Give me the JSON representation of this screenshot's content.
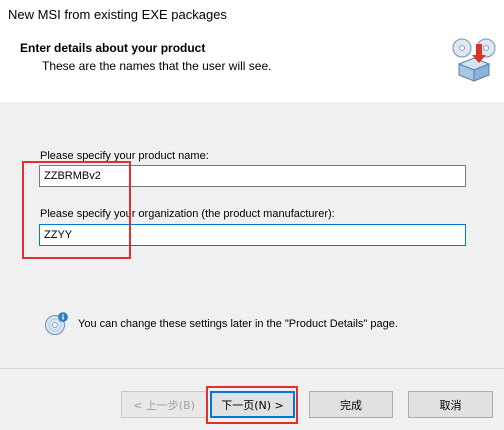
{
  "window": {
    "title": "New MSI from existing EXE packages"
  },
  "header": {
    "heading": "Enter details about your product",
    "subheading": "These are the names that the user will see."
  },
  "form": {
    "product_name_label": "Please specify your product name:",
    "product_name_value": "ZZBRMBv2",
    "organization_label": "Please specify your organization (the product manufacturer):",
    "organization_value": "ZZYY"
  },
  "info": {
    "text": "You can change these settings later in the \"Product Details\" page.",
    "icon": "cd-info-icon"
  },
  "buttons": {
    "back_label": "< 上一步(B)",
    "next_label": "下一页(N) >",
    "finish_label": "完成",
    "cancel_label": "取消"
  },
  "colors": {
    "annotation_red": "#e03030",
    "focus_blue": "#0078d7"
  }
}
